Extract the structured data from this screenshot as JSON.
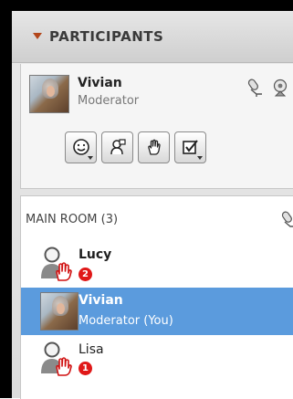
{
  "header": {
    "title": "PARTICIPANTS"
  },
  "me": {
    "name": "Vivian",
    "role": "Moderator"
  },
  "toolbar": {
    "buttons": [
      {
        "icon": "smiley-icon",
        "has_dropdown": true
      },
      {
        "icon": "presenter-icon",
        "has_dropdown": false
      },
      {
        "icon": "raise-hand-icon",
        "has_dropdown": false
      },
      {
        "icon": "checkbox-icon",
        "has_dropdown": true
      }
    ]
  },
  "room": {
    "title": "MAIN ROOM (3)",
    "participants": [
      {
        "name": "Lucy",
        "badge": "2",
        "avatar": "generic-user-hand-icon",
        "selected": false
      },
      {
        "name": "Vivian",
        "role": "Moderator (You)",
        "avatar": "photo",
        "selected": true
      },
      {
        "name": "Lisa",
        "badge": "1",
        "avatar": "generic-user-hand-icon",
        "selected": false
      }
    ]
  },
  "colors": {
    "accent": "#b3461a",
    "selection": "#5b9bdd",
    "badge": "#e01818"
  }
}
